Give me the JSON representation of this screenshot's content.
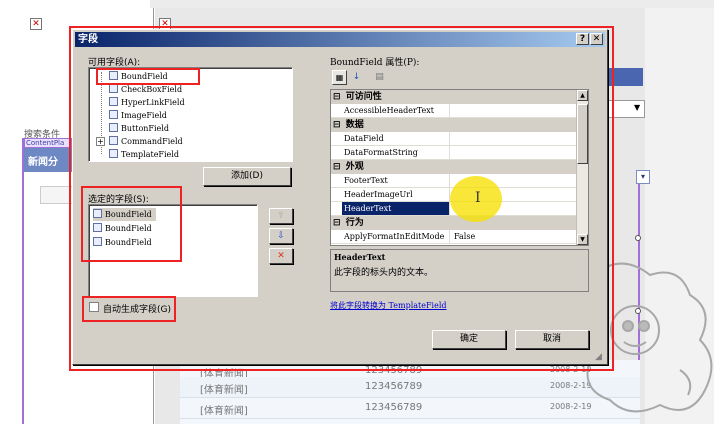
{
  "background": {
    "search_label": "搜索条件",
    "content_tag": "ContentPla",
    "news_header": "新闻分",
    "rows": [
      {
        "category": "[体育新闻]",
        "number": "123456789",
        "date": "2008-2-19"
      },
      {
        "category": "[体育新闻]",
        "number": "123456789",
        "date": "2008-2-19"
      },
      {
        "category": "[体育新闻]",
        "number": "123456789",
        "date": "2008-2-19"
      }
    ],
    "close_glyph": "✕"
  },
  "dialog": {
    "title": "字段",
    "help_btn": "?",
    "close_btn": "✕",
    "available_label": "可用字段(A):",
    "available_fields": [
      "BoundField",
      "CheckBoxField",
      "HyperLinkField",
      "ImageField",
      "ButtonField",
      "CommandField",
      "TemplateField"
    ],
    "add_button": "添加(D)",
    "selected_label": "选定的字段(S):",
    "selected_fields": [
      "BoundField",
      "BoundField",
      "BoundField"
    ],
    "auto_generate_label": "自动生成字段(G)",
    "properties_label": "BoundField 属性(P):",
    "categories": [
      {
        "name": "可访问性",
        "rows": [
          {
            "name": "AccessibleHeaderText",
            "value": ""
          }
        ]
      },
      {
        "name": "数据",
        "rows": [
          {
            "name": "DataField",
            "value": ""
          },
          {
            "name": "DataFormatString",
            "value": ""
          }
        ]
      },
      {
        "name": "外观",
        "rows": [
          {
            "name": "FooterText",
            "value": ""
          },
          {
            "name": "HeaderImageUrl",
            "value": ""
          },
          {
            "name": "HeaderText",
            "value": ""
          }
        ]
      },
      {
        "name": "行为",
        "rows": [
          {
            "name": "ApplyFormatInEditMode",
            "value": "False"
          }
        ]
      }
    ],
    "selected_property": "HeaderText",
    "description_title": "HeaderText",
    "description_text": "此字段的标头内的文本。",
    "convert_link": "将此字段转换为 TemplateField",
    "ok_button": "确定",
    "cancel_button": "取消"
  },
  "colors": {
    "title_start": "#0a246a",
    "title_end": "#a6caf0",
    "highlight_red": "#ee2222",
    "selection": "#0a246a",
    "cursor_halo": "#f6e000"
  },
  "icons": {
    "move_up": "up-arrow-icon",
    "move_down": "down-arrow-icon",
    "delete": "delete-x-icon",
    "categorized": "categorized-icon",
    "alphabetical": "alphabetical-sort-icon",
    "property_pages": "property-pages-icon",
    "cursor": "text-cursor-icon"
  }
}
